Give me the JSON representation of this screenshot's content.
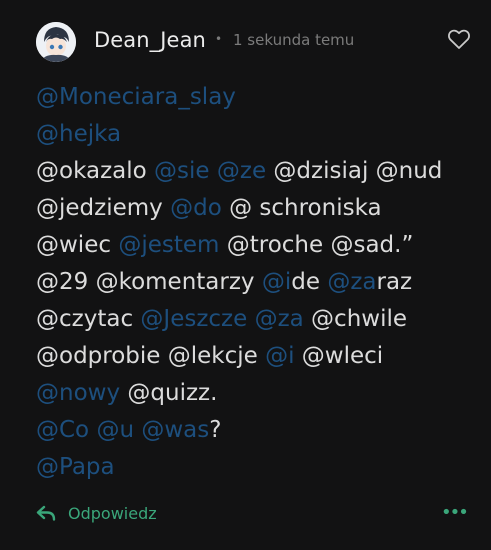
{
  "comment": {
    "username": "Dean_Jean",
    "separator": "•",
    "time": "1 sekunda temu",
    "lines": [
      [
        {
          "t": "@Moneciara_slay",
          "m": true
        }
      ],
      [
        {
          "t": "@hejka",
          "m": true
        }
      ],
      [
        {
          "t": "@okazalo ",
          "m": false
        },
        {
          "t": "@sie",
          "m": true
        },
        {
          "t": " ",
          "m": false
        },
        {
          "t": "@ze",
          "m": true
        },
        {
          "t": " @dzisiaj @nud",
          "m": false
        }
      ],
      [
        {
          "t": "@jedziemy ",
          "m": false
        },
        {
          "t": "@do",
          "m": true
        },
        {
          "t": " @ schroniska",
          "m": false
        }
      ],
      [
        {
          "t": "@wiec ",
          "m": false
        },
        {
          "t": "@jestem",
          "m": true
        },
        {
          "t": " @troche @sad.”",
          "m": false
        }
      ],
      [
        {
          "t": "@29 @komentarzy ",
          "m": false
        },
        {
          "t": "@i",
          "m": true
        },
        {
          "t": "de ",
          "m": false
        },
        {
          "t": "@za",
          "m": true
        },
        {
          "t": "raz",
          "m": false
        }
      ],
      [
        {
          "t": "@czytac ",
          "m": false
        },
        {
          "t": "@Jeszcze",
          "m": true
        },
        {
          "t": " ",
          "m": false
        },
        {
          "t": "@za",
          "m": true
        },
        {
          "t": " @chwile",
          "m": false
        }
      ],
      [
        {
          "t": "@odprobie @lekcje ",
          "m": false
        },
        {
          "t": "@i",
          "m": true
        },
        {
          "t": " @wleci",
          "m": false
        }
      ],
      [
        {
          "t": "@nowy",
          "m": true
        },
        {
          "t": " @quizz.",
          "m": false
        }
      ],
      [
        {
          "t": "@Co",
          "m": true
        },
        {
          "t": " ",
          "m": false
        },
        {
          "t": "@u",
          "m": true
        },
        {
          "t": " ",
          "m": false
        },
        {
          "t": "@was",
          "m": true
        },
        {
          "t": "?",
          "m": false
        }
      ],
      [
        {
          "t": "@Papa",
          "m": true
        }
      ]
    ]
  },
  "actions": {
    "reply_label": "Odpowiedz",
    "more_label": "•••"
  },
  "colors": {
    "background": "#121213",
    "text": "#dcdcdc",
    "mention": "#1d4f7e",
    "accent_green": "#3aa67a",
    "muted": "#7b7b7b"
  },
  "icons": {
    "like": "heart-icon",
    "reply": "reply-arrow-icon",
    "more": "more-dots-icon",
    "avatar": "user-avatar"
  }
}
